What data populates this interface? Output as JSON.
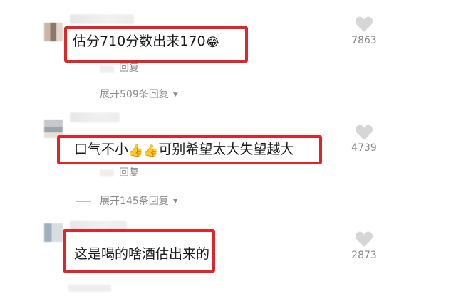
{
  "comments": [
    {
      "text": "估分710分数出来170",
      "emoji": "😂",
      "reply_label": "回复",
      "expand_label": "展开509条回复",
      "likes": "7863"
    },
    {
      "text_before": "口气不小",
      "emoji": "👍👍",
      "text_after": "可别希望太大失望越大",
      "reply_label": "回复",
      "expand_label": "展开145条回复",
      "likes": "4739"
    },
    {
      "text": "这是喝的啥酒估出来的",
      "likes": "2873"
    }
  ],
  "colors": {
    "highlight": "#e0242b",
    "muted_text": "#8a8a8a"
  },
  "icons": {
    "like": "heart-icon",
    "expand": "caret-down-icon"
  }
}
